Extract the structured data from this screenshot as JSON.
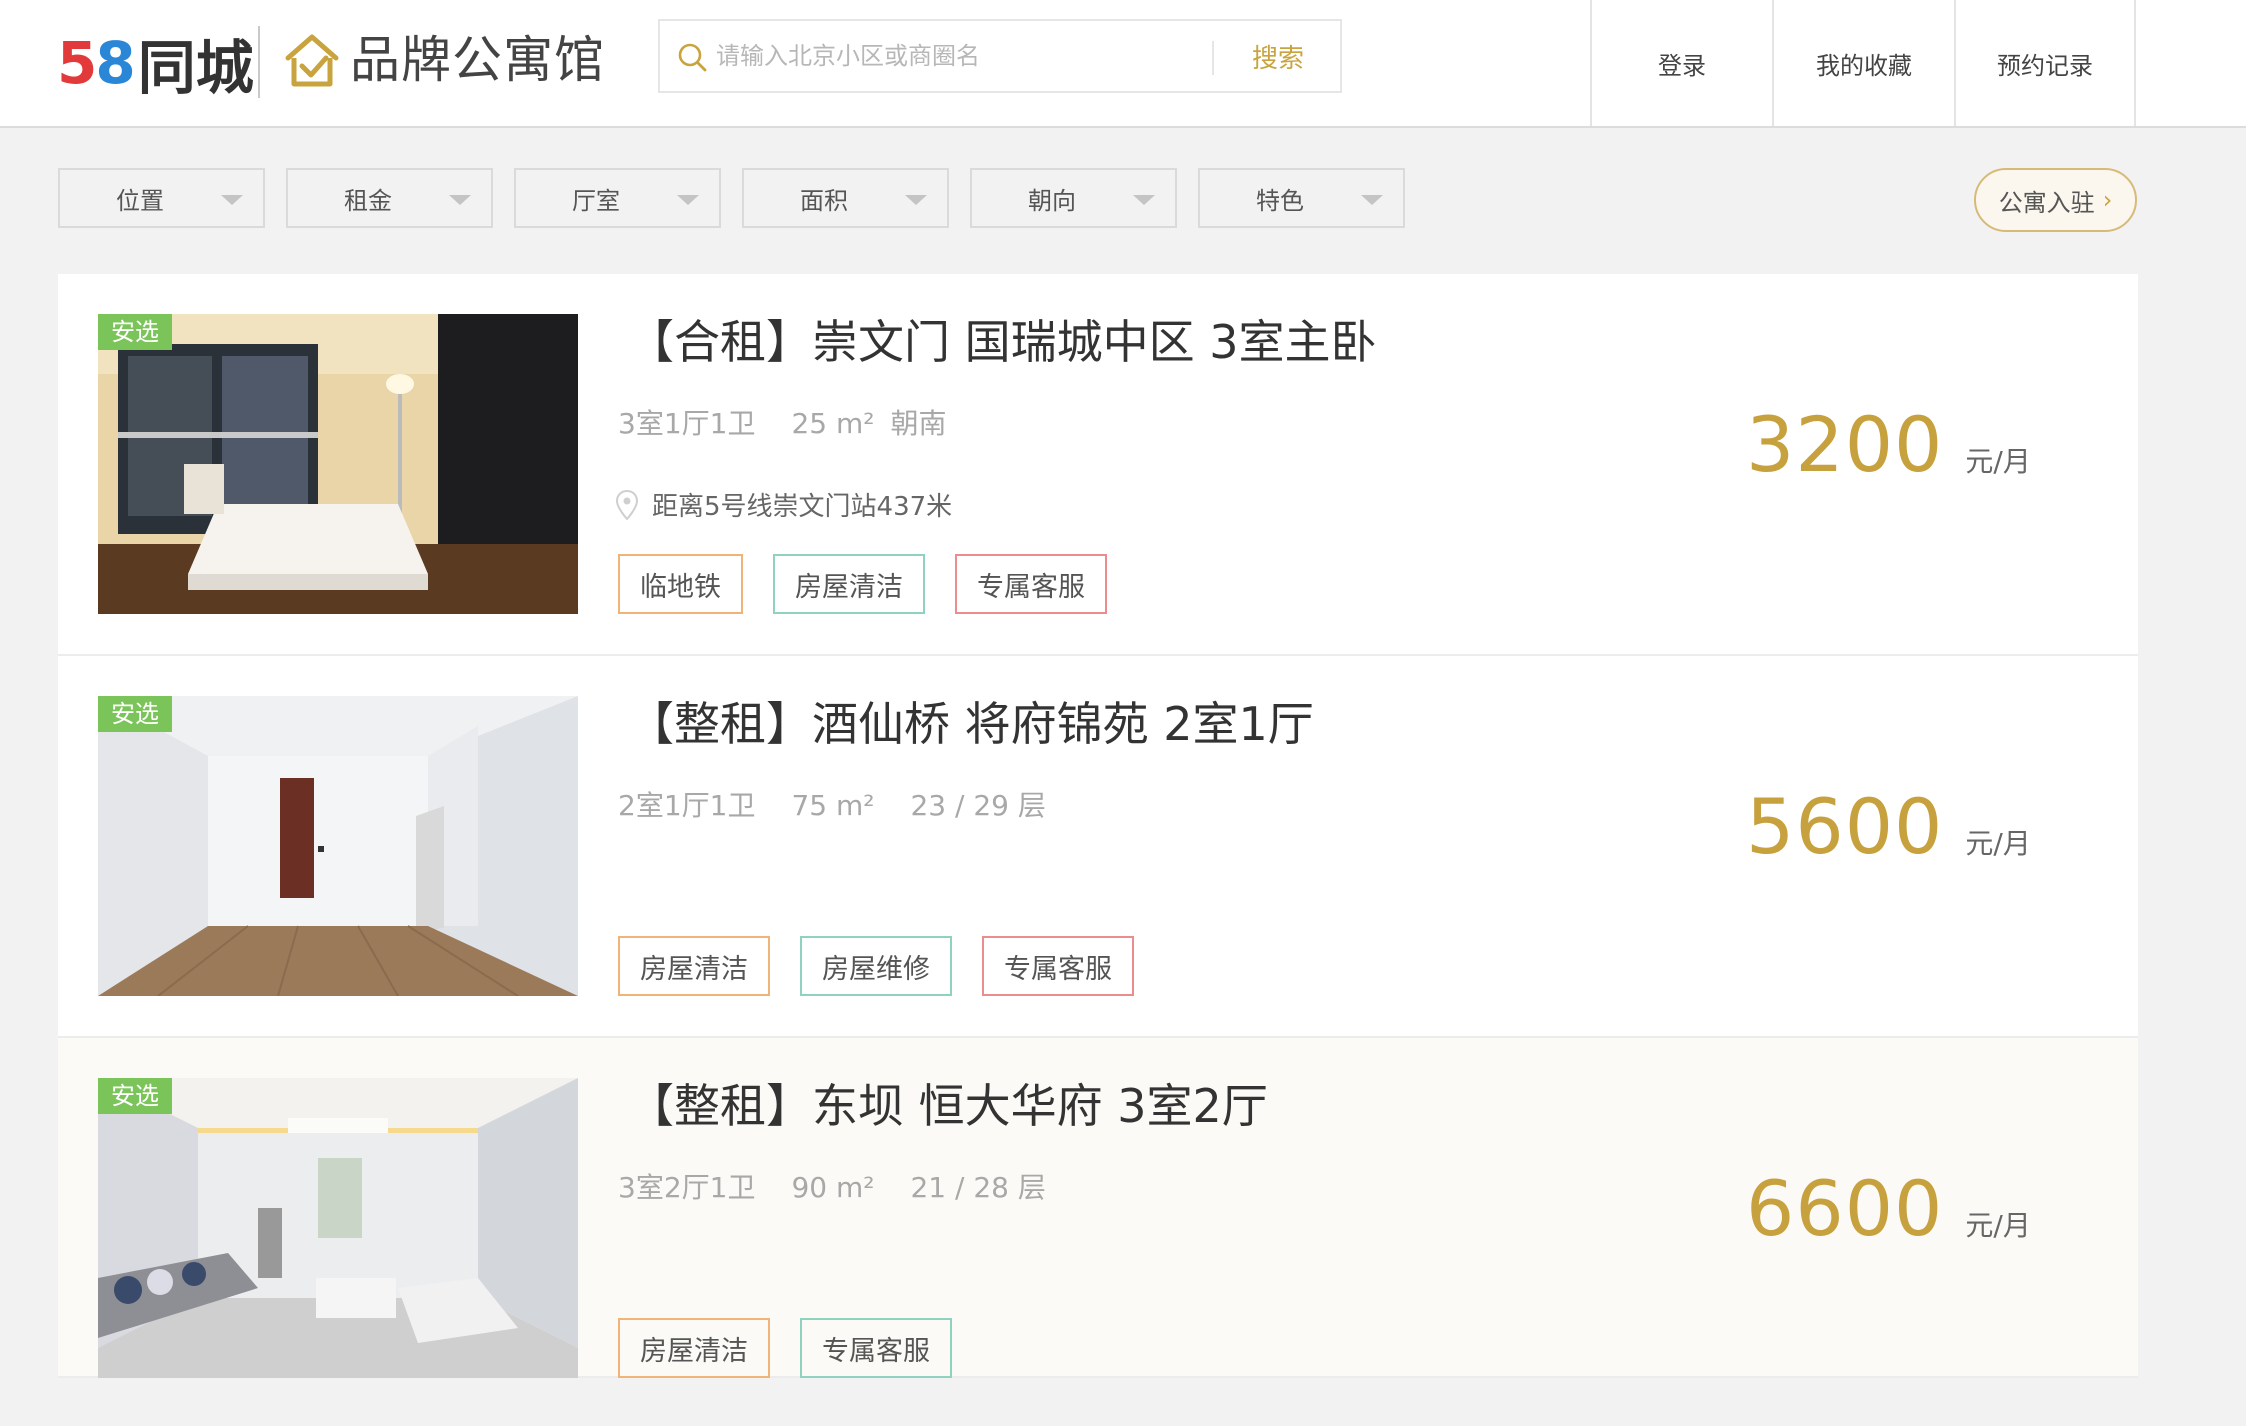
{
  "header": {
    "logo_digits": [
      "5",
      "8"
    ],
    "logo_text": "同城",
    "brand_text": "品牌公寓馆",
    "search": {
      "placeholder": "请输入北京小区或商圈名",
      "value": "",
      "button_label": "搜索"
    },
    "nav": [
      "登录",
      "我的收藏",
      "预约记录"
    ]
  },
  "filters": [
    "位置",
    "租金",
    "厅室",
    "面积",
    "朝向",
    "特色"
  ],
  "join_button": {
    "label": "公寓入驻",
    "icon": "chevron-right-icon"
  },
  "colors": {
    "accent_gold": "#c7a13d",
    "badge_green": "#7bc45a",
    "tag_orange": "#f0b478",
    "tag_green": "#8fd2c0",
    "tag_red": "#ec8d8d"
  },
  "listings": [
    {
      "badge": "安选",
      "title": "【合租】崇文门 国瑞城中区 3室主卧",
      "layout": "3室1厅1卫",
      "area": "25 m²",
      "extra": "朝南",
      "location": "距离5号线崇文门站437米",
      "tags": [
        {
          "label": "临地铁",
          "color": "orange"
        },
        {
          "label": "房屋清洁",
          "color": "green"
        },
        {
          "label": "专属客服",
          "color": "red"
        }
      ],
      "price": "3200",
      "unit": "元/月"
    },
    {
      "badge": "安选",
      "title": "【整租】酒仙桥 将府锦苑 2室1厅",
      "layout": "2室1厅1卫",
      "area": "75 m²",
      "extra": "23 / 29 层",
      "location": "",
      "tags": [
        {
          "label": "房屋清洁",
          "color": "orange"
        },
        {
          "label": "房屋维修",
          "color": "green"
        },
        {
          "label": "专属客服",
          "color": "red"
        }
      ],
      "price": "5600",
      "unit": "元/月"
    },
    {
      "badge": "安选",
      "title": "【整租】东坝 恒大华府 3室2厅",
      "layout": "3室2厅1卫",
      "area": "90 m²",
      "extra": "21 / 28 层",
      "location": "",
      "tags": [
        {
          "label": "房屋清洁",
          "color": "orange"
        },
        {
          "label": "专属客服",
          "color": "green"
        }
      ],
      "price": "6600",
      "unit": "元/月"
    }
  ]
}
